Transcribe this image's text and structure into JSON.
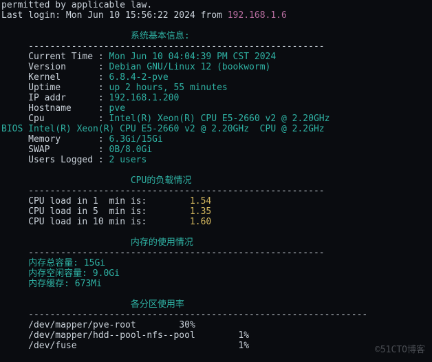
{
  "header": {
    "line1": "permitted by applicable law.",
    "last_login_prefix": "Last login:",
    "last_login_time": " Mon Jun 10 15:56:22 2024 from ",
    "last_login_ip": "192.168.1.6"
  },
  "sections": {
    "sysinfo_title": "系统基本信息:",
    "cpuload_title": "CPU的负载情况",
    "mem_title": "内存的使用情况",
    "disk_title": "各分区使用率"
  },
  "dashes": {
    "short": "-------------------------------------------------------",
    "long": "---------------------------------------------------------------"
  },
  "sys": {
    "k_time": "Current Time : ",
    "v_time": "Mon Jun 10 04:04:39 PM CST 2024",
    "k_ver": "Version      : ",
    "v_ver": "Debian GNU/Linux 12 (bookworm)",
    "k_kernel": "Kernel       : ",
    "v_kernel": "6.8.4-2-pve",
    "k_uptime": "Uptime       : ",
    "v_uptime": "up 2 hours, 55 minutes",
    "k_ip": "IP addr      : ",
    "v_ip": "192.168.1.200",
    "k_host": "Hostname     : ",
    "v_host": "pve",
    "k_cpu": "Cpu          : ",
    "v_cpu": "Intel(R) Xeon(R) CPU E5-2660 v2 @ 2.20GHz",
    "bios": "BIOS Intel(R) Xeon(R) CPU E5-2660 v2 @ 2.20GHz  CPU @ 2.2GHz",
    "k_mem": "Memory       : ",
    "v_mem": "6.3Gi/15Gi",
    "k_swap": "SWAP         : ",
    "v_swap": "0B/8.0Gi",
    "k_users": "Users Logged : ",
    "v_users": "2 users"
  },
  "cpu": {
    "l1": "CPU load in 1  min is:",
    "v1": "1.54",
    "l5": "CPU load in 5  min is:",
    "v5": "1.35",
    "l10": "CPU load in 10 min is:",
    "v10": "1.60"
  },
  "mem": {
    "l_total": "内存总容量: 15Gi",
    "l_free": "内存空闲容量: 9.0Gi",
    "l_cache": "内存缓存: 673Mi"
  },
  "disk": {
    "r1_dev": "/dev/mapper/pve-root",
    "r1_pct": "30%",
    "r2_dev": "/dev/mapper/hdd--pool-nfs--pool",
    "r2_pct": "1%",
    "r3_dev": "/dev/fuse",
    "r3_pct": "1%"
  },
  "watermark": "©51CTO博客"
}
